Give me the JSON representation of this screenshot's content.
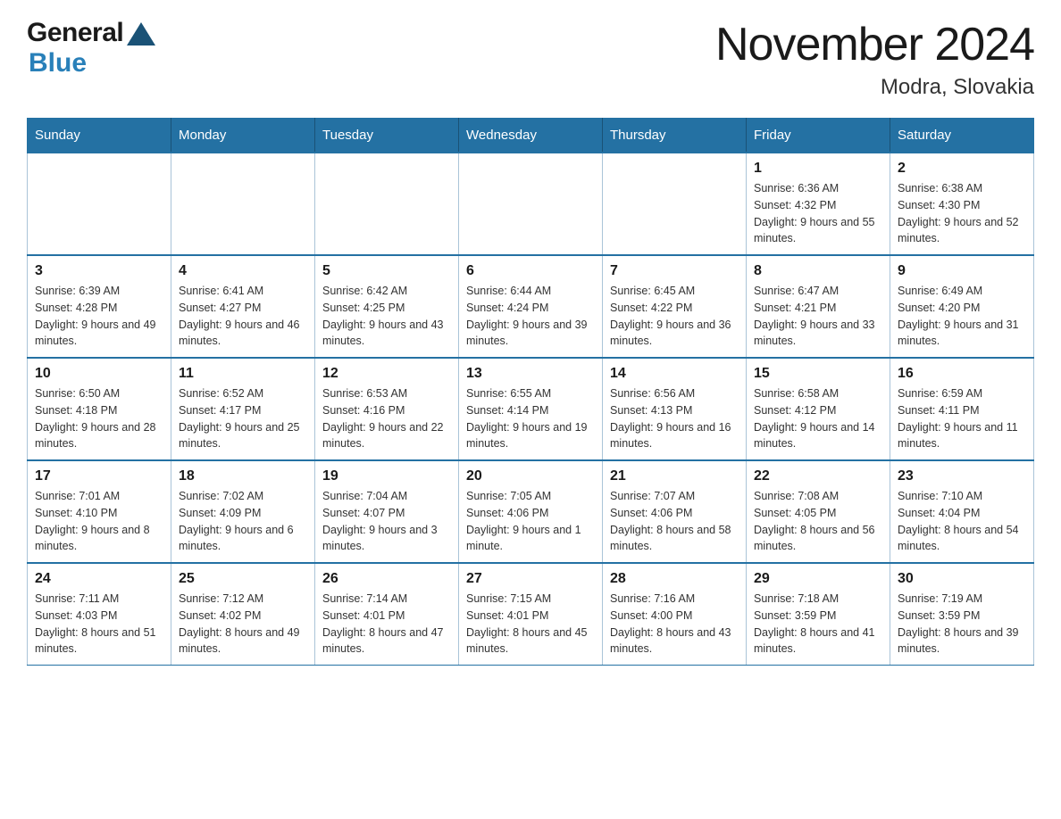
{
  "header": {
    "logo": {
      "general": "General",
      "blue": "Blue",
      "triangle": "▲"
    },
    "title": "November 2024",
    "subtitle": "Modra, Slovakia"
  },
  "calendar": {
    "days_of_week": [
      "Sunday",
      "Monday",
      "Tuesday",
      "Wednesday",
      "Thursday",
      "Friday",
      "Saturday"
    ],
    "weeks": [
      [
        {
          "day": "",
          "info": ""
        },
        {
          "day": "",
          "info": ""
        },
        {
          "day": "",
          "info": ""
        },
        {
          "day": "",
          "info": ""
        },
        {
          "day": "",
          "info": ""
        },
        {
          "day": "1",
          "info": "Sunrise: 6:36 AM\nSunset: 4:32 PM\nDaylight: 9 hours and 55 minutes."
        },
        {
          "day": "2",
          "info": "Sunrise: 6:38 AM\nSunset: 4:30 PM\nDaylight: 9 hours and 52 minutes."
        }
      ],
      [
        {
          "day": "3",
          "info": "Sunrise: 6:39 AM\nSunset: 4:28 PM\nDaylight: 9 hours and 49 minutes."
        },
        {
          "day": "4",
          "info": "Sunrise: 6:41 AM\nSunset: 4:27 PM\nDaylight: 9 hours and 46 minutes."
        },
        {
          "day": "5",
          "info": "Sunrise: 6:42 AM\nSunset: 4:25 PM\nDaylight: 9 hours and 43 minutes."
        },
        {
          "day": "6",
          "info": "Sunrise: 6:44 AM\nSunset: 4:24 PM\nDaylight: 9 hours and 39 minutes."
        },
        {
          "day": "7",
          "info": "Sunrise: 6:45 AM\nSunset: 4:22 PM\nDaylight: 9 hours and 36 minutes."
        },
        {
          "day": "8",
          "info": "Sunrise: 6:47 AM\nSunset: 4:21 PM\nDaylight: 9 hours and 33 minutes."
        },
        {
          "day": "9",
          "info": "Sunrise: 6:49 AM\nSunset: 4:20 PM\nDaylight: 9 hours and 31 minutes."
        }
      ],
      [
        {
          "day": "10",
          "info": "Sunrise: 6:50 AM\nSunset: 4:18 PM\nDaylight: 9 hours and 28 minutes."
        },
        {
          "day": "11",
          "info": "Sunrise: 6:52 AM\nSunset: 4:17 PM\nDaylight: 9 hours and 25 minutes."
        },
        {
          "day": "12",
          "info": "Sunrise: 6:53 AM\nSunset: 4:16 PM\nDaylight: 9 hours and 22 minutes."
        },
        {
          "day": "13",
          "info": "Sunrise: 6:55 AM\nSunset: 4:14 PM\nDaylight: 9 hours and 19 minutes."
        },
        {
          "day": "14",
          "info": "Sunrise: 6:56 AM\nSunset: 4:13 PM\nDaylight: 9 hours and 16 minutes."
        },
        {
          "day": "15",
          "info": "Sunrise: 6:58 AM\nSunset: 4:12 PM\nDaylight: 9 hours and 14 minutes."
        },
        {
          "day": "16",
          "info": "Sunrise: 6:59 AM\nSunset: 4:11 PM\nDaylight: 9 hours and 11 minutes."
        }
      ],
      [
        {
          "day": "17",
          "info": "Sunrise: 7:01 AM\nSunset: 4:10 PM\nDaylight: 9 hours and 8 minutes."
        },
        {
          "day": "18",
          "info": "Sunrise: 7:02 AM\nSunset: 4:09 PM\nDaylight: 9 hours and 6 minutes."
        },
        {
          "day": "19",
          "info": "Sunrise: 7:04 AM\nSunset: 4:07 PM\nDaylight: 9 hours and 3 minutes."
        },
        {
          "day": "20",
          "info": "Sunrise: 7:05 AM\nSunset: 4:06 PM\nDaylight: 9 hours and 1 minute."
        },
        {
          "day": "21",
          "info": "Sunrise: 7:07 AM\nSunset: 4:06 PM\nDaylight: 8 hours and 58 minutes."
        },
        {
          "day": "22",
          "info": "Sunrise: 7:08 AM\nSunset: 4:05 PM\nDaylight: 8 hours and 56 minutes."
        },
        {
          "day": "23",
          "info": "Sunrise: 7:10 AM\nSunset: 4:04 PM\nDaylight: 8 hours and 54 minutes."
        }
      ],
      [
        {
          "day": "24",
          "info": "Sunrise: 7:11 AM\nSunset: 4:03 PM\nDaylight: 8 hours and 51 minutes."
        },
        {
          "day": "25",
          "info": "Sunrise: 7:12 AM\nSunset: 4:02 PM\nDaylight: 8 hours and 49 minutes."
        },
        {
          "day": "26",
          "info": "Sunrise: 7:14 AM\nSunset: 4:01 PM\nDaylight: 8 hours and 47 minutes."
        },
        {
          "day": "27",
          "info": "Sunrise: 7:15 AM\nSunset: 4:01 PM\nDaylight: 8 hours and 45 minutes."
        },
        {
          "day": "28",
          "info": "Sunrise: 7:16 AM\nSunset: 4:00 PM\nDaylight: 8 hours and 43 minutes."
        },
        {
          "day": "29",
          "info": "Sunrise: 7:18 AM\nSunset: 3:59 PM\nDaylight: 8 hours and 41 minutes."
        },
        {
          "day": "30",
          "info": "Sunrise: 7:19 AM\nSunset: 3:59 PM\nDaylight: 8 hours and 39 minutes."
        }
      ]
    ]
  }
}
